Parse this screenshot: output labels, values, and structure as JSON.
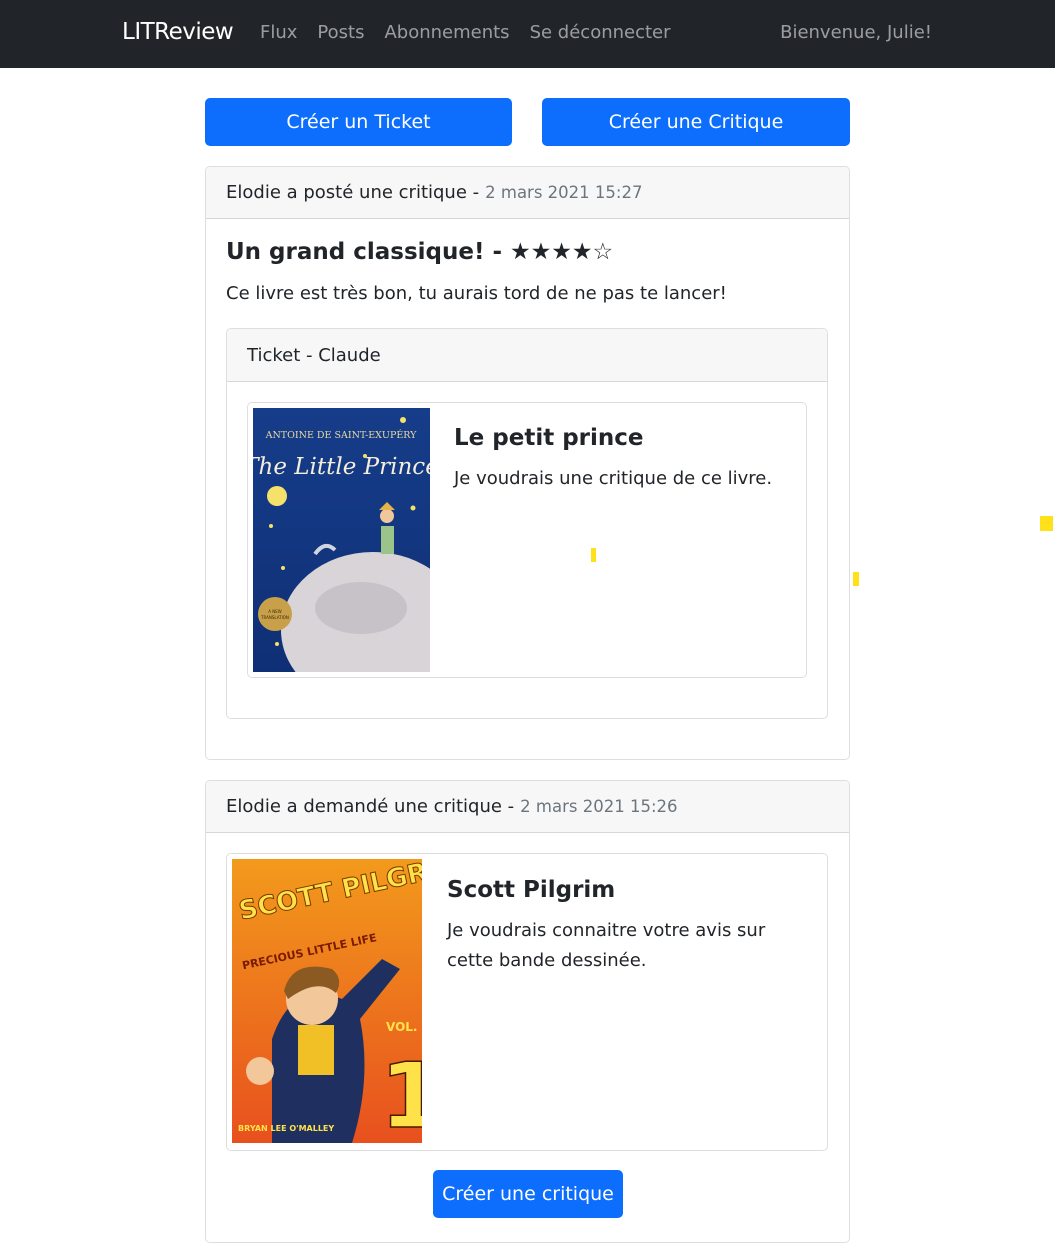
{
  "navbar": {
    "brand": "LITReview",
    "links": [
      "Flux",
      "Posts",
      "Abonnements",
      "Se déconnecter"
    ],
    "welcome": "Bienvenue, Julie!"
  },
  "actions": {
    "create_ticket": "Créer un Ticket",
    "create_review": "Créer une Critique"
  },
  "posts": [
    {
      "header_text": "Elodie a posté une critique -",
      "date": "2 mars 2021 15:27",
      "review_title": "Un grand classique! - ★★★★☆",
      "review_body": "Ce livre est très bon, tu aurais tord de ne pas te lancer!",
      "ticket": {
        "header": "Ticket - Claude",
        "book_title": "Le petit prince",
        "book_description": "Je voudrais une critique de ce livre.",
        "cover": {
          "author": "ANTOINE DE SAINT-EXUPÉRY",
          "title": "The Little Prince"
        }
      }
    },
    {
      "header_text": "Elodie a demandé une critique -",
      "date": "2 mars 2021 15:26",
      "ticket": {
        "book_title": "Scott Pilgrim",
        "book_description": "Je voudrais connaitre votre avis sur cette bande dessinée.",
        "cover": {
          "title": "SCOTT PILGRIM'S",
          "subtitle": "PRECIOUS LITTLE LIFE",
          "volume_label": "VOL.",
          "volume_number": "1",
          "author": "BRYAN LEE O'MALLEY"
        }
      },
      "create_review_button": "Créer une critique"
    }
  ],
  "colors": {
    "navbar": "#212529",
    "primary": "#0d6efd",
    "muted": "#6c757d"
  }
}
